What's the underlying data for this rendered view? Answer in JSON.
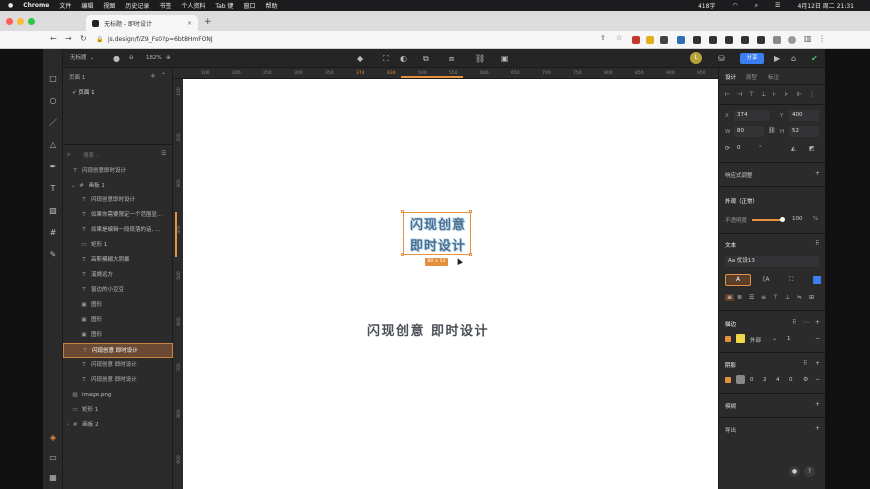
{
  "menubar": {
    "apple": "",
    "items": [
      "Chrome",
      "文件",
      "编辑",
      "视图",
      "历史记录",
      "书签",
      "个人资料",
      "Tab 键",
      "窗口",
      "帮助"
    ],
    "word_count": "418字",
    "datetime": "4月12日 周二  21:31"
  },
  "browser": {
    "tab_title": "无标题 - 即时设计",
    "tab_close": "×",
    "new_tab": "+",
    "url": "js.design/f/Z9_Fs0?p=6bt8HmFONJ"
  },
  "app_toolbar": {
    "file_name": "无标题",
    "zoom": "182%",
    "share_label": "分享",
    "avatar_letter": "L"
  },
  "layers": {
    "pages_label": "页面 1",
    "page_item": "页面 1",
    "search_placeholder": "搜索...",
    "items": [
      {
        "label": "闪现创意即时设计",
        "icon": "T",
        "indent": 1,
        "selected": false
      },
      {
        "label": "画板 1",
        "icon": "#",
        "indent": 1,
        "selected": false
      },
      {
        "label": "闪现创意即时设计",
        "icon": "T",
        "indent": 2,
        "selected": false
      },
      {
        "label": "如果你需要限定一个范围显...",
        "icon": "T",
        "indent": 2,
        "selected": false
      },
      {
        "label": "如果是编辑一段段落的话, ...",
        "icon": "T",
        "indent": 2,
        "selected": false
      },
      {
        "label": "矩形 1",
        "icon": "▭",
        "indent": 2,
        "selected": false
      },
      {
        "label": "高斯模糊大阴暴",
        "icon": "T",
        "indent": 2,
        "selected": false
      },
      {
        "label": "溪娩远方",
        "icon": "T",
        "indent": 2,
        "selected": false
      },
      {
        "label": "窗边的小豆豆",
        "icon": "T",
        "indent": 2,
        "selected": false
      },
      {
        "label": "图形",
        "icon": "▣",
        "indent": 2,
        "selected": false
      },
      {
        "label": "图形",
        "icon": "▣",
        "indent": 2,
        "selected": false
      },
      {
        "label": "图形",
        "icon": "▣",
        "indent": 2,
        "selected": false
      },
      {
        "label": "闪现创意 即时设计",
        "icon": "T",
        "indent": 2,
        "selected": true
      },
      {
        "label": "闪现创意 即时设计",
        "icon": "T",
        "indent": 2,
        "selected": false
      },
      {
        "label": "闪现创意 即时设计",
        "icon": "T",
        "indent": 2,
        "selected": false
      },
      {
        "label": "image.png",
        "icon": "▨",
        "indent": 1,
        "selected": false
      },
      {
        "label": "矩形 1",
        "icon": "▭",
        "indent": 1,
        "selected": false
      },
      {
        "label": "画板 2",
        "icon": "#",
        "indent": 0,
        "selected": false
      }
    ]
  },
  "rulers": {
    "h_ticks": [
      "100",
      "200",
      "250",
      "300",
      "350",
      "374",
      "434",
      "500",
      "550",
      "600",
      "650",
      "700",
      "750",
      "800",
      "850",
      "900",
      "950"
    ],
    "v_ticks": [
      "100",
      "200",
      "300",
      "400",
      "500",
      "600",
      "700",
      "800",
      "900"
    ]
  },
  "canvas": {
    "graphic_line1": "闪现创意",
    "graphic_line2": "即时设计",
    "size_badge": "80 × 52",
    "big_text": "闪现创意  即时设计"
  },
  "props": {
    "tabs": [
      "设计",
      "原型",
      "标注"
    ],
    "x_label": "X",
    "x_value": "374",
    "y_label": "Y",
    "y_value": "400",
    "w_label": "W",
    "w_value": "80",
    "h_label": "H",
    "h_value": "52",
    "rotation": "0",
    "rotation_unit": "°",
    "responsive_label": "响应式调整",
    "appearance_label": "外观（正常）",
    "opacity_label": "不透明度",
    "opacity_value": "100",
    "opacity_unit": "%",
    "text_section": "文本",
    "font_name": "Aa  优设13",
    "stroke_section": "描边",
    "stroke_position": "外部",
    "stroke_width": "1",
    "shadow_section": "阴影",
    "shadow_values": [
      "0",
      "2",
      "4",
      "0"
    ],
    "blur_section": "模糊",
    "export_section": "导出",
    "stroke_color": "#f1d64a",
    "fill_color": "#e8915a",
    "accent": "#e5903f"
  }
}
